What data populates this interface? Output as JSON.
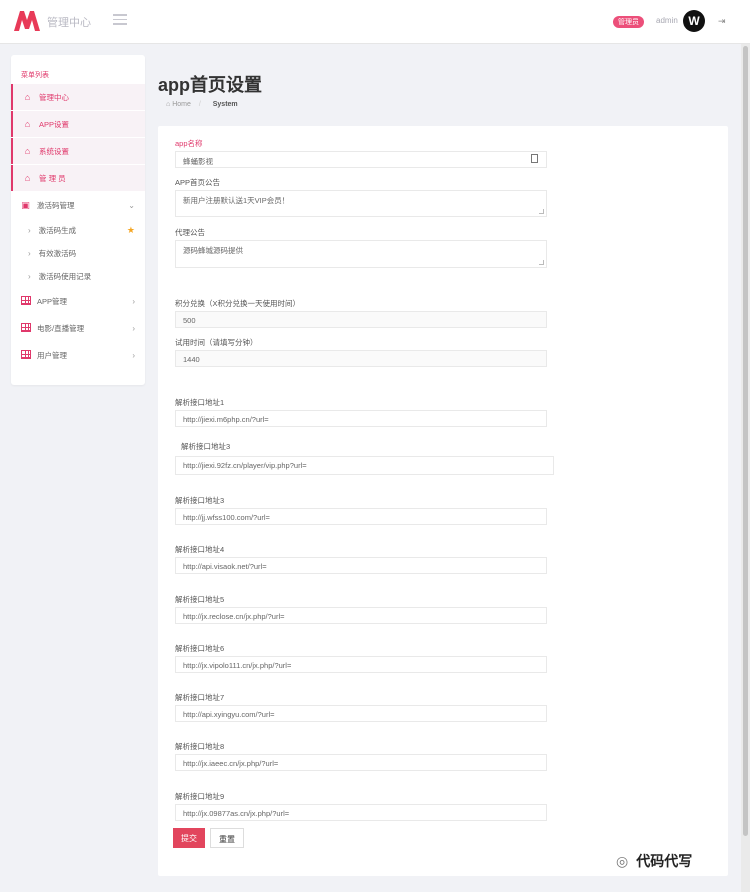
{
  "header": {
    "brand": "管理中心",
    "role_badge": "管理员",
    "username": "admin",
    "avatar_letter": "W",
    "accent": "#e0386b"
  },
  "sidebar": {
    "title": "菜单列表",
    "items": [
      {
        "label": "管理中心"
      },
      {
        "label": "APP设置"
      },
      {
        "label": "系统设置"
      },
      {
        "label": "管 理 员"
      },
      {
        "label": "激活码管理"
      },
      {
        "label": "激活码生成"
      },
      {
        "label": "有效激活码"
      },
      {
        "label": "激活码使用记录"
      },
      {
        "label": "APP管理"
      },
      {
        "label": "电影/直播管理"
      },
      {
        "label": "用户管理"
      }
    ]
  },
  "page": {
    "title": "app首页设置",
    "breadcrumb_home": "Home",
    "breadcrumb_current": "System"
  },
  "form": {
    "app_name_label": "app名称",
    "app_name_value": "蜂蛹影视",
    "notice_label": "APP首页公告",
    "notice_value": "新用户注册默认送1天VIP会员！",
    "agent_label": "代理公告",
    "agent_value": "源码蜂城源码提供",
    "points_label": "积分兑换（X积分兑换一天使用时间）",
    "points_value": "500",
    "trial_label": "试用时间（请填写分钟）",
    "trial_value": "1440",
    "ghost_overlay": "解析接口地址3",
    "apis": [
      {
        "label": "解析接口地址1",
        "value": "http://jiexi.m6php.cn/?url="
      },
      {
        "label": "解析接口地址3",
        "value": "http://jiexi.92fz.cn/player/vip.php?url="
      },
      {
        "label": "解析接口地址3",
        "value": "http://jj.wfss100.com/?url="
      },
      {
        "label": "解析接口地址4",
        "value": "http://api.visaok.net/?url="
      },
      {
        "label": "解析接口地址5",
        "value": "http://jx.reclose.cn/jx.php/?url="
      },
      {
        "label": "解析接口地址6",
        "value": "http://jx.vipolo111.cn/jx.php/?url="
      },
      {
        "label": "解析接口地址7",
        "value": "http://api.xyingyu.com/?url="
      },
      {
        "label": "解析接口地址8",
        "value": "http://jx.iaeec.cn/jx.php/?url="
      },
      {
        "label": "解析接口地址9",
        "value": "http://jx.09877as.cn/jx.php/?url="
      }
    ],
    "submit_label": "提交",
    "reset_label": "重置"
  },
  "watermark": "代码代写"
}
